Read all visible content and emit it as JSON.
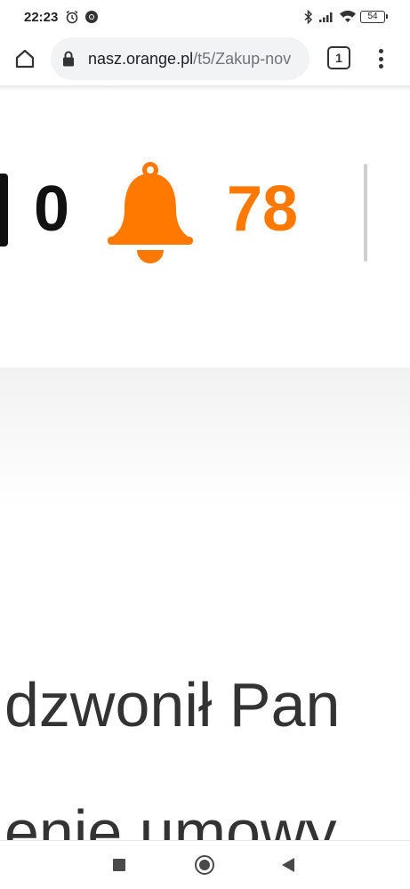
{
  "status_bar": {
    "time": "22:23",
    "battery_level": "54",
    "icons": [
      "alarm-icon",
      "chrome-icon",
      "bluetooth-icon",
      "signal-icon",
      "wifi-icon",
      "battery-icon"
    ]
  },
  "browser": {
    "url_host": "nasz.orange.pl",
    "url_path": "/t5/Zakup-nov",
    "tab_count": "1",
    "icons": [
      "home-icon",
      "lock-icon",
      "overflow-menu-icon"
    ]
  },
  "page": {
    "message_count": "0",
    "notification_count": "78",
    "body_lines": [
      "dzwonił Pan",
      "enie umowy"
    ],
    "colors": {
      "accent": "#ff7900",
      "text_dark": "#111111",
      "body_text": "#333333"
    }
  },
  "nav_bar": {
    "icons": [
      "recents-icon",
      "home-icon",
      "back-icon"
    ]
  }
}
